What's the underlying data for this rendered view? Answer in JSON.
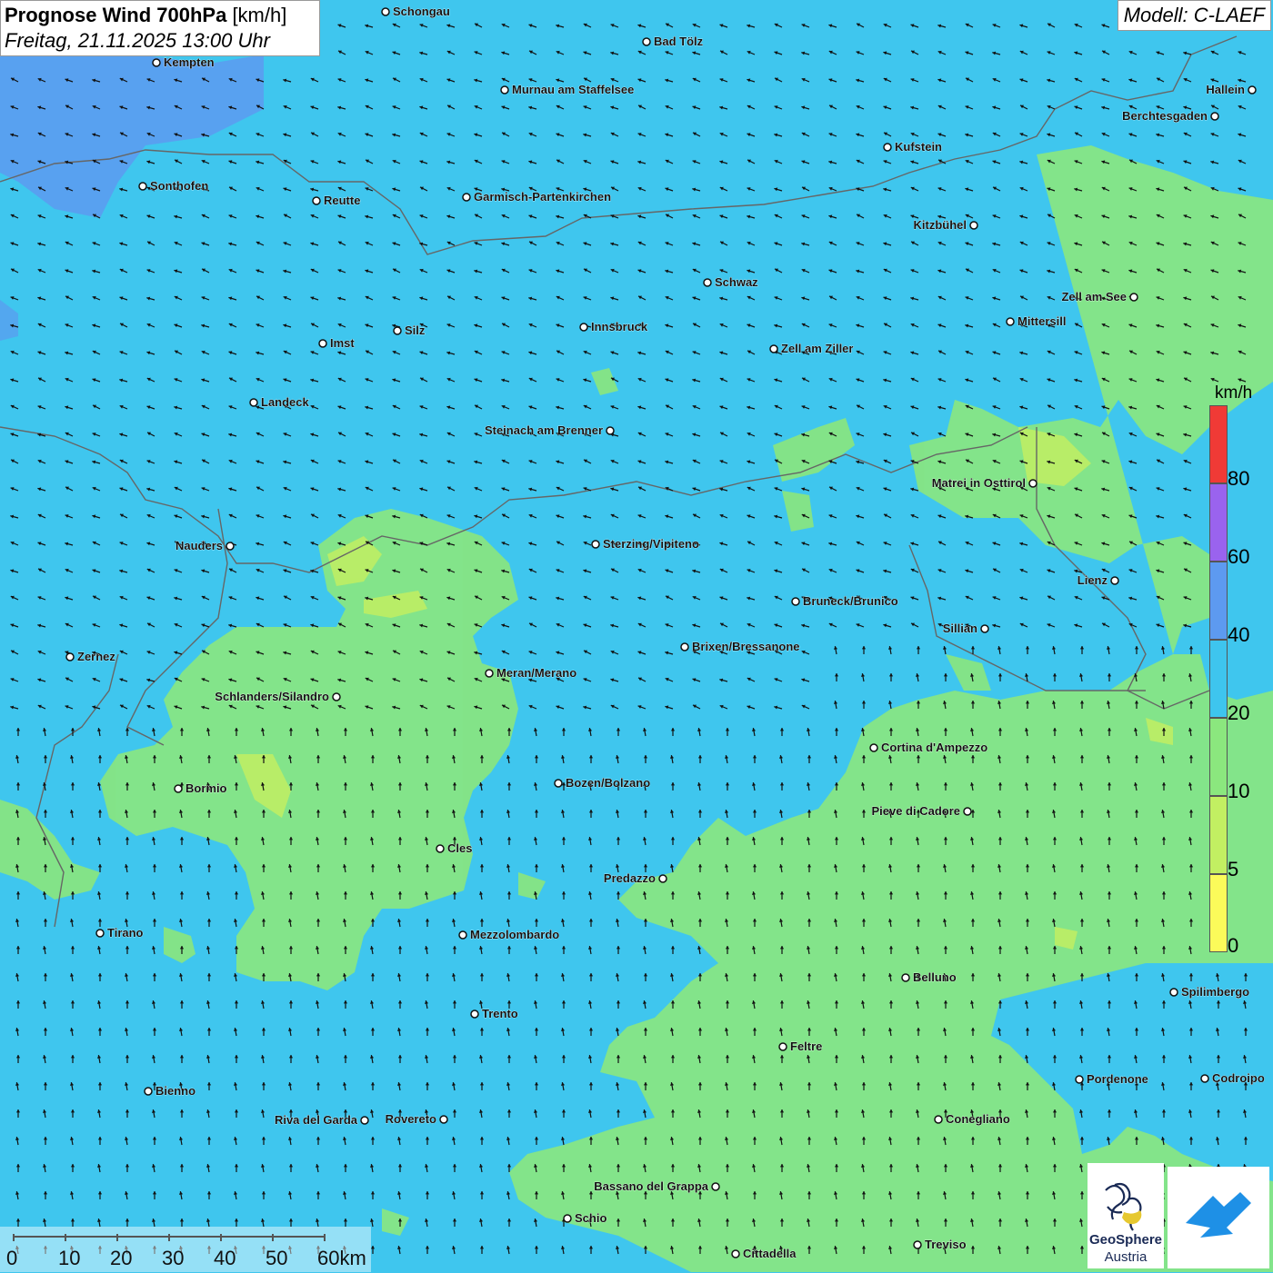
{
  "header": {
    "title_bold": "Prognose Wind 700hPa",
    "title_unit": "[km/h]",
    "datetime": "Freitag, 21.11.2025 13:00 Uhr",
    "model": "Modell: C-LAEF"
  },
  "legend": {
    "unit": "km/h",
    "classes": [
      {
        "label": "0",
        "color": "#fbfb5a"
      },
      {
        "label": "5",
        "color": "#c2ef62"
      },
      {
        "label": "10",
        "color": "#8be77e"
      },
      {
        "label": "20",
        "color": "#3ec5ee"
      },
      {
        "label": "40",
        "color": "#5d9af0"
      },
      {
        "label": "60",
        "color": "#9a63ee"
      },
      {
        "label": "80",
        "color": "#f03a36"
      }
    ]
  },
  "scalebar": {
    "labels": [
      "0",
      "10",
      "20",
      "30",
      "40",
      "50",
      "60km"
    ]
  },
  "logos": {
    "geosphere_line1": "GeoSphere",
    "geosphere_line2": "Austria"
  },
  "cities": [
    {
      "name": "Schongau"
    },
    {
      "name": "Bad Tölz"
    },
    {
      "name": "Kempten"
    },
    {
      "name": "Murnau am Staffelsee"
    },
    {
      "name": "Hallein"
    },
    {
      "name": "Berchtesgaden"
    },
    {
      "name": "Kufstein"
    },
    {
      "name": "Sonthofen"
    },
    {
      "name": "Reutte"
    },
    {
      "name": "Garmisch-Partenkirchen"
    },
    {
      "name": "Kitzbühel"
    },
    {
      "name": "Schwaz"
    },
    {
      "name": "Zell am See"
    },
    {
      "name": "Mittersill"
    },
    {
      "name": "Imst"
    },
    {
      "name": "Silz"
    },
    {
      "name": "Innsbruck"
    },
    {
      "name": "Zell am Ziller"
    },
    {
      "name": "Landeck"
    },
    {
      "name": "Steinach am Brenner"
    },
    {
      "name": "Matrei in Osttirol"
    },
    {
      "name": "Nauders"
    },
    {
      "name": "Sterzing/Vipiteno"
    },
    {
      "name": "Lienz"
    },
    {
      "name": "Bruneck/Brunico"
    },
    {
      "name": "Sillian"
    },
    {
      "name": "Brixen/Bressanone"
    },
    {
      "name": "Zernez"
    },
    {
      "name": "Meran/Merano"
    },
    {
      "name": "Schlanders/Silandro"
    },
    {
      "name": "Cortina d'Ampezzo"
    },
    {
      "name": "Bozen/Bolzano"
    },
    {
      "name": "Bormio"
    },
    {
      "name": "Pieve di Cadore"
    },
    {
      "name": "Cles"
    },
    {
      "name": "Predazzo"
    },
    {
      "name": "Tirano"
    },
    {
      "name": "Mezzolombardo"
    },
    {
      "name": "Belluno"
    },
    {
      "name": "Spilimbergo"
    },
    {
      "name": "Trento"
    },
    {
      "name": "Feltre"
    },
    {
      "name": "Bienno"
    },
    {
      "name": "Pordenone"
    },
    {
      "name": "Codroipo"
    },
    {
      "name": "Riva del Garda"
    },
    {
      "name": "Rovereto"
    },
    {
      "name": "Conegliano"
    },
    {
      "name": "Bassano del Grappa"
    },
    {
      "name": "Schio"
    },
    {
      "name": "Treviso"
    },
    {
      "name": "Cittadella"
    }
  ],
  "wind_field": {
    "direction_description": "wind from south-east / east over most of the area",
    "north_region_speed_class": "20-40",
    "south_region_speed_class": "10-20"
  }
}
